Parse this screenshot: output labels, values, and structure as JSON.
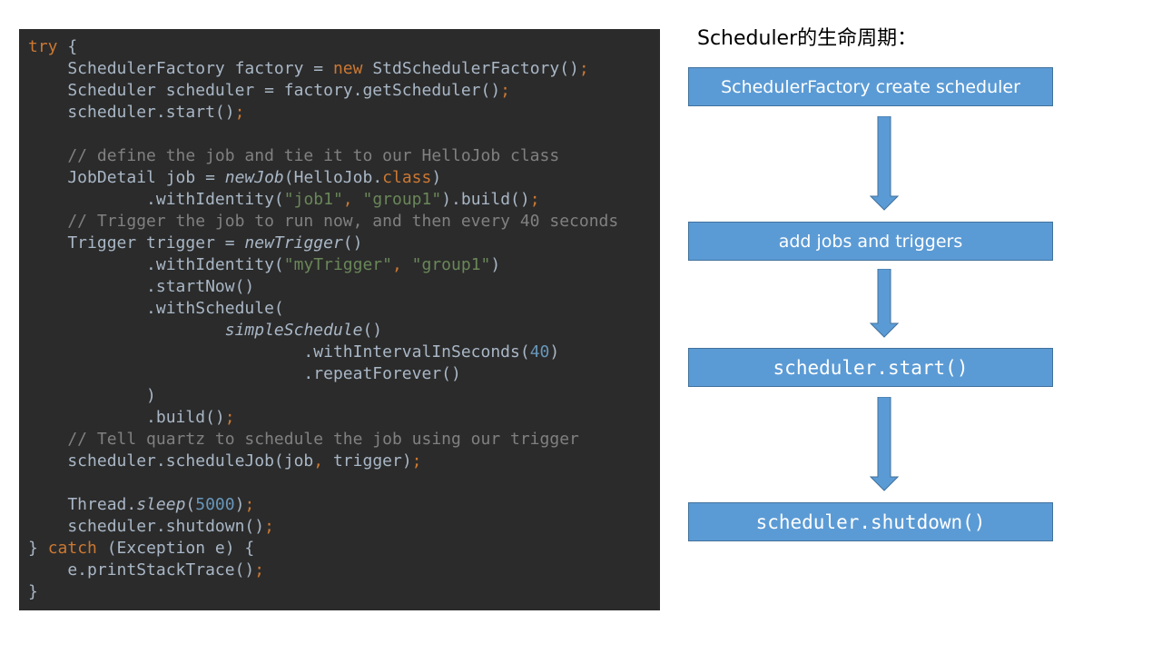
{
  "code": {
    "lines": [
      [
        {
          "t": "try ",
          "c": "kw"
        },
        {
          "t": "{",
          "c": ""
        }
      ],
      [
        {
          "t": "    SchedulerFactory factory = ",
          "c": ""
        },
        {
          "t": "new ",
          "c": "kw"
        },
        {
          "t": "StdSchedulerFactory()",
          "c": ""
        },
        {
          "t": ";",
          "c": "semi"
        }
      ],
      [
        {
          "t": "    Scheduler scheduler = factory.getScheduler()",
          "c": ""
        },
        {
          "t": ";",
          "c": "semi"
        }
      ],
      [
        {
          "t": "    scheduler.start()",
          "c": ""
        },
        {
          "t": ";",
          "c": "semi"
        }
      ],
      [],
      [
        {
          "t": "    // define the job and tie it to our HelloJob class",
          "c": "cmt"
        }
      ],
      [
        {
          "t": "    JobDetail job = ",
          "c": ""
        },
        {
          "t": "newJob",
          "c": "it"
        },
        {
          "t": "(HelloJob.",
          "c": ""
        },
        {
          "t": "class",
          "c": "kw"
        },
        {
          "t": ")",
          "c": ""
        }
      ],
      [
        {
          "t": "            .withIdentity(",
          "c": ""
        },
        {
          "t": "\"job1\"",
          "c": "str"
        },
        {
          "t": ", ",
          "c": "kw"
        },
        {
          "t": "\"group1\"",
          "c": "str"
        },
        {
          "t": ").build()",
          "c": ""
        },
        {
          "t": ";",
          "c": "semi"
        }
      ],
      [
        {
          "t": "    // Trigger the job to run now, and then every 40 seconds",
          "c": "cmt"
        }
      ],
      [
        {
          "t": "    Trigger trigger = ",
          "c": ""
        },
        {
          "t": "newTrigger",
          "c": "it"
        },
        {
          "t": "()",
          "c": ""
        }
      ],
      [
        {
          "t": "            .withIdentity(",
          "c": ""
        },
        {
          "t": "\"myTrigger\"",
          "c": "str"
        },
        {
          "t": ", ",
          "c": "kw"
        },
        {
          "t": "\"group1\"",
          "c": "str"
        },
        {
          "t": ")",
          "c": ""
        }
      ],
      [
        {
          "t": "            .startNow()",
          "c": ""
        }
      ],
      [
        {
          "t": "            .withSchedule(",
          "c": ""
        }
      ],
      [
        {
          "t": "                    ",
          "c": ""
        },
        {
          "t": "simpleSchedule",
          "c": "it"
        },
        {
          "t": "()",
          "c": ""
        }
      ],
      [
        {
          "t": "                            .withIntervalInSeconds(",
          "c": ""
        },
        {
          "t": "40",
          "c": "num"
        },
        {
          "t": ")",
          "c": ""
        }
      ],
      [
        {
          "t": "                            .repeatForever()",
          "c": ""
        }
      ],
      [
        {
          "t": "            )",
          "c": ""
        }
      ],
      [
        {
          "t": "            .build()",
          "c": ""
        },
        {
          "t": ";",
          "c": "semi"
        }
      ],
      [
        {
          "t": "    // Tell quartz to schedule the job using our trigger",
          "c": "cmt"
        }
      ],
      [
        {
          "t": "    scheduler.scheduleJob(job",
          "c": ""
        },
        {
          "t": ", ",
          "c": "kw"
        },
        {
          "t": "trigger)",
          "c": ""
        },
        {
          "t": ";",
          "c": "semi"
        }
      ],
      [],
      [
        {
          "t": "    Thread.",
          "c": ""
        },
        {
          "t": "sleep",
          "c": "it"
        },
        {
          "t": "(",
          "c": ""
        },
        {
          "t": "5000",
          "c": "num"
        },
        {
          "t": ")",
          "c": ""
        },
        {
          "t": ";",
          "c": "semi"
        }
      ],
      [
        {
          "t": "    scheduler.shutdown()",
          "c": ""
        },
        {
          "t": ";",
          "c": "semi"
        }
      ],
      [
        {
          "t": "} ",
          "c": ""
        },
        {
          "t": "catch ",
          "c": "kw"
        },
        {
          "t": "(Exception e) {",
          "c": ""
        }
      ],
      [
        {
          "t": "    e.printStackTrace()",
          "c": ""
        },
        {
          "t": ";",
          "c": "semi"
        }
      ],
      [
        {
          "t": "}",
          "c": ""
        }
      ]
    ],
    "colors": {
      "background": "#2b2b2b",
      "text": "#a9b7c6",
      "keyword": "#cc7832",
      "string": "#6a8759",
      "number": "#6897bb",
      "comment": "#808080"
    }
  },
  "diagram": {
    "title": "Scheduler的生命周期：",
    "steps": [
      {
        "label": "SchedulerFactory create scheduler"
      },
      {
        "label": "add jobs and triggers"
      },
      {
        "label": "scheduler.start()"
      },
      {
        "label": "scheduler.shutdown()"
      }
    ],
    "colors": {
      "box_fill": "#5b9bd5",
      "box_border": "#41719c",
      "arrow_fill": "#5b9bd5"
    }
  }
}
